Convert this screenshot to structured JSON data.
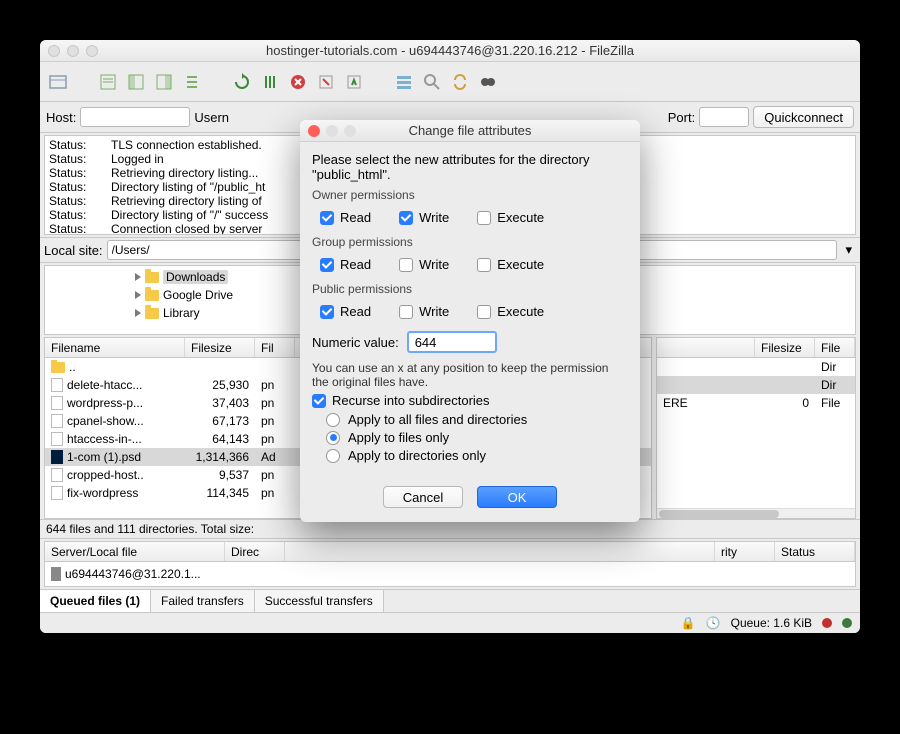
{
  "window_title": "hostinger-tutorials.com - u694443746@31.220.16.212 - FileZilla",
  "conn": {
    "host_label": "Host:",
    "user_label": "Usern",
    "port_label": "Port:",
    "quickconnect": "Quickconnect"
  },
  "log": [
    {
      "k": "Status:",
      "v": "TLS connection established."
    },
    {
      "k": "Status:",
      "v": "Logged in"
    },
    {
      "k": "Status:",
      "v": "Retrieving directory listing..."
    },
    {
      "k": "Status:",
      "v": "Directory listing of \"/public_ht"
    },
    {
      "k": "Status:",
      "v": "Retrieving directory listing of "
    },
    {
      "k": "Status:",
      "v": "Directory listing of \"/\" success"
    },
    {
      "k": "Status:",
      "v": "Connection closed by server"
    }
  ],
  "localsite_label": "Local site:",
  "localsite_value": "/Users/",
  "tree": [
    {
      "name": "Downloads",
      "sel": true
    },
    {
      "name": "Google Drive",
      "sel": false
    },
    {
      "name": "Library",
      "sel": false
    }
  ],
  "left_cols": {
    "c1": "Filename",
    "c2": "Filesize",
    "c3": "Fil"
  },
  "right_cols": {
    "c1": "",
    "c2": "Filesize",
    "c3": "File"
  },
  "left_rows": [
    {
      "name": "..",
      "size": "",
      "type": "",
      "icon": "folder"
    },
    {
      "name": "delete-htacc...",
      "size": "25,930",
      "type": "pn",
      "icon": "file"
    },
    {
      "name": "wordpress-p...",
      "size": "37,403",
      "type": "pn",
      "icon": "file"
    },
    {
      "name": "cpanel-show...",
      "size": "67,173",
      "type": "pn",
      "icon": "file"
    },
    {
      "name": "htaccess-in-...",
      "size": "64,143",
      "type": "pn",
      "icon": "file"
    },
    {
      "name": "1-com (1).psd",
      "size": "1,314,366",
      "type": "Ad",
      "icon": "psd",
      "hl": true
    },
    {
      "name": "cropped-host..",
      "size": "9,537",
      "type": "pn",
      "icon": "file"
    },
    {
      "name": "fix-wordpress",
      "size": "114,345",
      "type": "pn",
      "icon": "file"
    }
  ],
  "right_rows": [
    {
      "name": "",
      "size": "",
      "type": "Dir"
    },
    {
      "name": "",
      "size": "",
      "type": "Dir"
    },
    {
      "name": "ERE",
      "size": "0",
      "type": "File"
    }
  ],
  "statusline": "644 files and 111 directories. Total size:",
  "queue_cols": {
    "a": "Server/Local file",
    "b": "Direc",
    "c": "rity",
    "d": "Status"
  },
  "queue_row": "u694443746@31.220.1...",
  "tabs": {
    "a": "Queued files (1)",
    "b": "Failed transfers",
    "c": "Successful transfers"
  },
  "bottom": {
    "queue": "Queue: 1.6 KiB"
  },
  "modal": {
    "title": "Change file attributes",
    "prompt1": "Please select the new attributes for the directory",
    "prompt2": "\"public_html\".",
    "owner_label": "Owner permissions",
    "group_label": "Group permissions",
    "public_label": "Public permissions",
    "read": "Read",
    "write": "Write",
    "exec": "Execute",
    "numeric_label": "Numeric value:",
    "numeric_value": "644",
    "hint": "You can use an x at any position to keep the permission the original files have.",
    "recurse": "Recurse into subdirectories",
    "r1": "Apply to all files and directories",
    "r2": "Apply to files only",
    "r3": "Apply to directories only",
    "cancel": "Cancel",
    "ok": "OK"
  }
}
